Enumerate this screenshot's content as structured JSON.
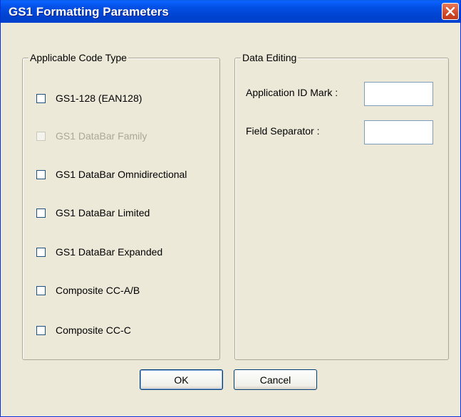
{
  "window": {
    "title": "GS1 Formatting Parameters"
  },
  "code_type": {
    "legend": "Applicable Code Type",
    "items": [
      {
        "label": "GS1-128 (EAN128)",
        "checked": false,
        "enabled": true
      },
      {
        "label": "GS1 DataBar Family",
        "checked": false,
        "enabled": false
      },
      {
        "label": "GS1 DataBar Omnidirectional",
        "checked": false,
        "enabled": true
      },
      {
        "label": "GS1 DataBar Limited",
        "checked": false,
        "enabled": true
      },
      {
        "label": "GS1 DataBar Expanded",
        "checked": false,
        "enabled": true
      },
      {
        "label": "Composite CC-A/B",
        "checked": false,
        "enabled": true
      },
      {
        "label": "Composite CC-C",
        "checked": false,
        "enabled": true
      }
    ]
  },
  "data_editing": {
    "legend": "Data Editing",
    "app_id_label": "Application ID Mark :",
    "app_id_value": "",
    "field_sep_label": "Field Separator :",
    "field_sep_value": ""
  },
  "buttons": {
    "ok": "OK",
    "cancel": "Cancel"
  }
}
